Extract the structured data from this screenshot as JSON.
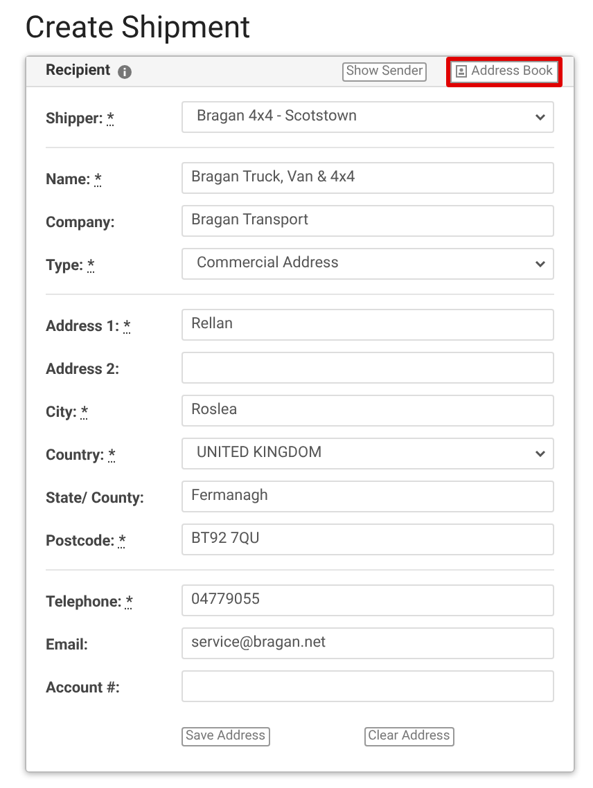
{
  "title": "Create Shipment",
  "panel": {
    "heading": "Recipient",
    "header_buttons": [
      {
        "label": "Show Sender",
        "kind": "plain",
        "highlighted": false
      },
      {
        "label": "Address Book",
        "kind": "book",
        "highlighted": true
      }
    ]
  },
  "sections": [
    {
      "fields": [
        {
          "label": "Shipper:",
          "required_mark": "*",
          "kind": "select",
          "value": "Bragan 4x4 - Scotstown"
        }
      ]
    },
    {
      "fields": [
        {
          "label": "Name:",
          "required_mark": "*",
          "kind": "input",
          "value": "Bragan Truck, Van & 4x4"
        },
        {
          "label": "Company:",
          "kind": "input",
          "value": "Bragan Transport"
        },
        {
          "label": "Type:",
          "required_mark": "*",
          "kind": "select",
          "value": "Commercial Address"
        }
      ]
    },
    {
      "fields": [
        {
          "label": "Address 1:",
          "required_mark": "*",
          "kind": "input",
          "value": "Rellan"
        },
        {
          "label": "Address 2:",
          "kind": "input"
        },
        {
          "label": "City:",
          "required_mark": "*",
          "kind": "input",
          "value": "Roslea"
        },
        {
          "label": "Country:",
          "required_mark": "*",
          "kind": "select",
          "value": "UNITED KINGDOM"
        },
        {
          "label": "State/ County:",
          "kind": "input",
          "value": "Fermanagh"
        },
        {
          "label": "Postcode:",
          "required_mark": "*",
          "kind": "input",
          "value": "BT92 7QU"
        }
      ]
    },
    {
      "fields": [
        {
          "label": "Telephone:",
          "required_mark": "*",
          "kind": "input",
          "value": "04779055"
        },
        {
          "label": "Email:",
          "kind": "input",
          "value": "service@bragan.net"
        },
        {
          "label": "Account #:",
          "kind": "input"
        }
      ]
    }
  ],
  "footer_buttons": [
    "Save Address",
    "Clear Address"
  ]
}
